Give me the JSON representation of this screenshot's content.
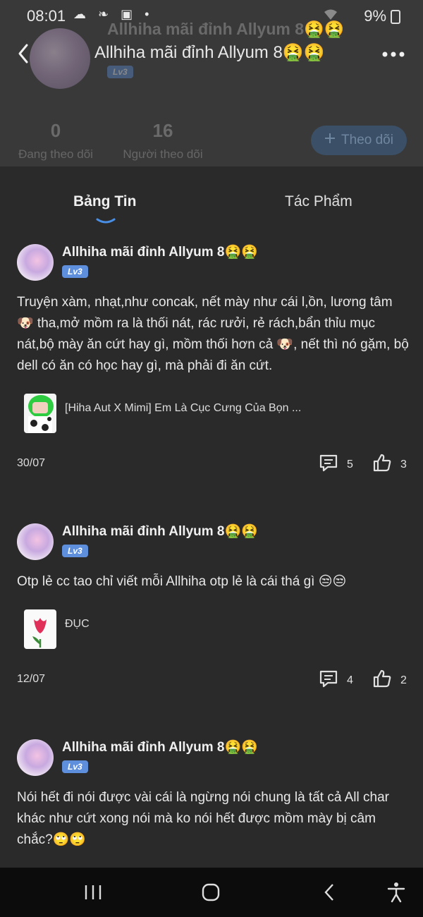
{
  "status": {
    "time": "08:01",
    "icons": "☁ ❧ ▣ •",
    "battery": "9%"
  },
  "header": {
    "title": "Allhiha mãi đỉnh Allyum 8🤮🤮",
    "ghost_title": "Allhiha mãi đỉnh Allyum 8🤮🤮",
    "level": "Lv3",
    "following_count": "0",
    "following_label": "Đang theo dõi",
    "followers_count": "16",
    "followers_label": "Người theo dõi",
    "follow_label": "Theo dõi"
  },
  "tabs": [
    {
      "label": "Bảng Tin"
    },
    {
      "label": "Tác Phẩm"
    }
  ],
  "posts": [
    {
      "author": "Allhiha mãi đỉnh Allyum 8🤮🤮",
      "level": "Lv3",
      "body": "Truyện xàm, nhạt,như concak, nết mày như cái l,ồn, lương tâm 🐶 tha,mở mồm ra là thối nát, rác rưởi, rẻ rách,bẩn thỉu mục nát,bộ mày ăn cứt hay gì, mồm thối hơn cả 🐶, nết thì nó gặm, bộ dell có ăn có học hay gì, mà phải đi ăn cứt.",
      "linked_title": "[Hiha Aut X Mimi] Em Là Cục Cưng Của Bọn ...",
      "date": "30/07",
      "comments": "5",
      "likes": "3"
    },
    {
      "author": "Allhiha mãi đỉnh Allyum 8🤮🤮",
      "level": "Lv3",
      "body": "Otp lẻ cc tao chỉ viết mỗi Allhiha otp lẻ là cái thá gì 😒😒",
      "linked_title": "ĐỤC",
      "date": "12/07",
      "comments": "4",
      "likes": "2"
    },
    {
      "author": "Allhiha mãi đỉnh Allyum 8🤮🤮",
      "level": "Lv3",
      "body": "Nói hết đi nói được vài cái là ngừng nói chung là tất cả All char khác như cứt xong nói mà ko nói hết được mồm mày bị câm chắc?🙄🙄"
    }
  ],
  "colors": {
    "accent": "#4a8fe6",
    "background": "#2a2a2a",
    "header": "#393939",
    "level_badge": "#5e8fdc"
  }
}
